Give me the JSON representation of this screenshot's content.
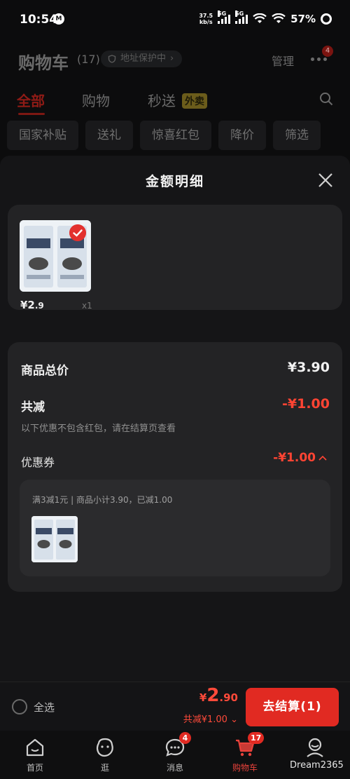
{
  "status_bar": {
    "time": "10:54",
    "net_speed_value": "37.5",
    "net_speed_unit": "kb/s",
    "signal1_label": "5G",
    "signal2_label": "5G",
    "battery": "57%"
  },
  "header": {
    "title": "购物车",
    "count": "(17)",
    "address_protection": "地址保护中",
    "manage": "管理",
    "more_badge": "4"
  },
  "tabs": {
    "all": "全部",
    "shopping": "购物",
    "express": "秒送",
    "express_badge": "外卖"
  },
  "chips": [
    "国家补贴",
    "送礼",
    "惊喜红包",
    "降价",
    "筛选"
  ],
  "sheet": {
    "title": "金额明细",
    "product": {
      "price_yen": "¥2",
      "price_dec": ".9",
      "qty": "x1"
    },
    "detail": {
      "total_label": "商品总价",
      "total_value": "¥3.90",
      "discount_label": "共减",
      "discount_value": "-¥1.00",
      "note": "以下优惠不包含红包，请在结算页查看",
      "coupon_label": "优惠券",
      "coupon_value": "-¥1.00",
      "coupon_desc": "满3减1元 | 商品小计3.90，已减1.00"
    }
  },
  "checkout": {
    "select_all": "全选",
    "total_yen": "¥",
    "total_int": "2",
    "total_dec": ".90",
    "discount": "共减¥1.00",
    "button": "去结算(1)"
  },
  "nav": {
    "home": "首页",
    "browse": "逛",
    "messages": "消息",
    "messages_badge": "4",
    "cart": "购物车",
    "cart_badge": "17",
    "me": "我的"
  },
  "watermark": "Dream2365",
  "colors": {
    "accent": "#e12a22",
    "price_red": "#ff4433",
    "background": "#0c0c0d",
    "sheet": "#151517",
    "card": "#232325"
  }
}
